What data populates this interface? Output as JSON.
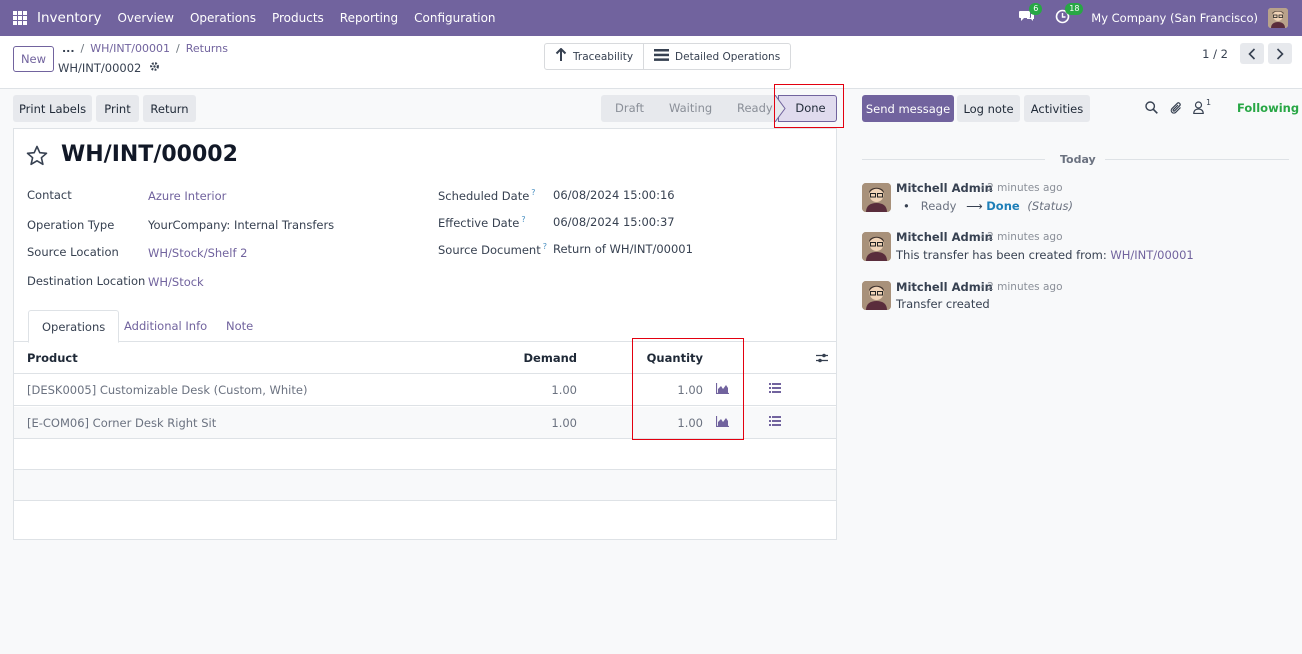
{
  "navbar": {
    "app_name": "Inventory",
    "menu": [
      "Overview",
      "Operations",
      "Products",
      "Reporting",
      "Configuration"
    ],
    "messages_count": "6",
    "activities_count": "18",
    "company": "My Company (San Francisco)"
  },
  "control": {
    "new_label": "New",
    "breadcrumb_ellipsis": "...",
    "breadcrumb": [
      "WH/INT/00001",
      "Returns"
    ],
    "record_name": "WH/INT/00002",
    "smart_buttons": [
      "Traceability",
      "Detailed Operations"
    ],
    "pager_value": "1 / 2"
  },
  "actions": {
    "print_labels": "Print Labels",
    "print": "Print",
    "return": "Return"
  },
  "statusbar": {
    "stages": [
      "Draft",
      "Waiting",
      "Ready",
      "Done"
    ],
    "current": "Done"
  },
  "form": {
    "title": "WH/INT/00002",
    "left_fields": [
      {
        "label": "Contact",
        "value": "Azure Interior"
      },
      {
        "label": "Operation Type",
        "value": "YourCompany: Internal Transfers"
      },
      {
        "label": "Source Location",
        "value": "WH/Stock/Shelf 2"
      },
      {
        "label": "Destination Location",
        "value": "WH/Stock"
      }
    ],
    "right_fields": [
      {
        "label": "Scheduled Date",
        "value": "06/08/2024 15:00:16"
      },
      {
        "label": "Effective Date",
        "value": "06/08/2024 15:00:37"
      },
      {
        "label": "Source Document",
        "value": "Return of WH/INT/00001"
      }
    ],
    "help_mark": "?",
    "tabs": [
      "Operations",
      "Additional Info",
      "Note"
    ],
    "table": {
      "headers": [
        "Product",
        "Demand",
        "Quantity"
      ],
      "rows": [
        {
          "product": "[DESK0005] Customizable Desk (Custom, White)",
          "demand": "1.00",
          "quantity": "1.00"
        },
        {
          "product": "[E-COM06] Corner Desk Right Sit",
          "demand": "1.00",
          "quantity": "1.00"
        }
      ]
    }
  },
  "chatter": {
    "send_message": "Send message",
    "log_note": "Log note",
    "activities": "Activities",
    "followers_count": "1",
    "following": "Following",
    "today": "Today",
    "messages": [
      {
        "author": "Mitchell Admin",
        "time": "- 2 minutes ago",
        "from_state": "Ready",
        "arrow": "⟶",
        "to_state": "Done",
        "field": "(Status)"
      },
      {
        "author": "Mitchell Admin",
        "time": "- 2 minutes ago",
        "text": "This transfer has been created from:",
        "link": "WH/INT/00001"
      },
      {
        "author": "Mitchell Admin",
        "time": "- 2 minutes ago",
        "text": "Transfer created"
      }
    ]
  },
  "colors": {
    "brand": "#71639e",
    "highlight": "#e3000f",
    "following": "#28a745"
  }
}
